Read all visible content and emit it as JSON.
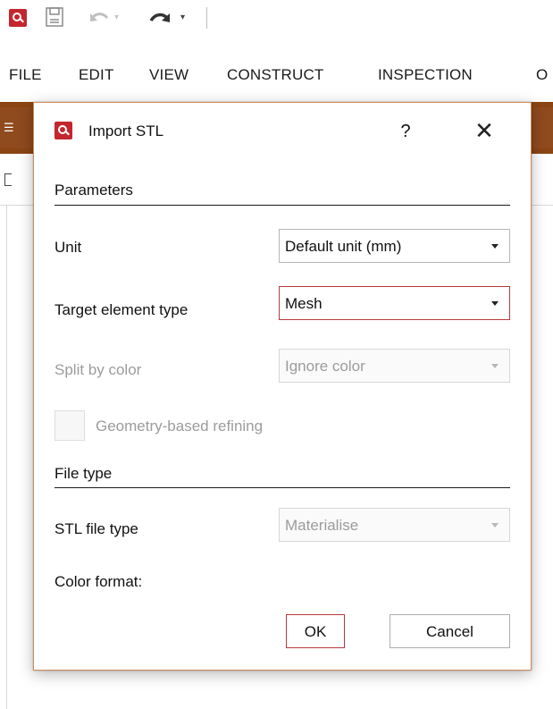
{
  "quick_access": {
    "icons": [
      "app-logo-icon",
      "save-icon",
      "undo-icon",
      "redo-icon"
    ],
    "dropdown_glyph": "▾"
  },
  "menu": {
    "items": [
      "FILE",
      "EDIT",
      "VIEW",
      "CONSTRUCT",
      "INSPECTION",
      "O"
    ]
  },
  "ribbon": {
    "accent_color": "#8b4513",
    "menu_glyph": "☰"
  },
  "dialog": {
    "title": "Import STL",
    "help_label": "?",
    "close_label": "✕",
    "sections": {
      "parameters_title": "Parameters",
      "file_type_title": "File type"
    },
    "fields": {
      "unit_label": "Unit",
      "unit_value": "Default unit (mm)",
      "target_label": "Target element type",
      "target_value": "Mesh",
      "split_label": "Split by color",
      "split_value": "Ignore color",
      "refining_label": "Geometry-based refining",
      "stl_type_label": "STL file type",
      "stl_type_value": "Materialise",
      "color_format_label": "Color format:"
    },
    "buttons": {
      "ok": "OK",
      "cancel": "Cancel"
    },
    "colors": {
      "focus_border": "#b63a3a",
      "brand_red": "#c4262e"
    }
  }
}
